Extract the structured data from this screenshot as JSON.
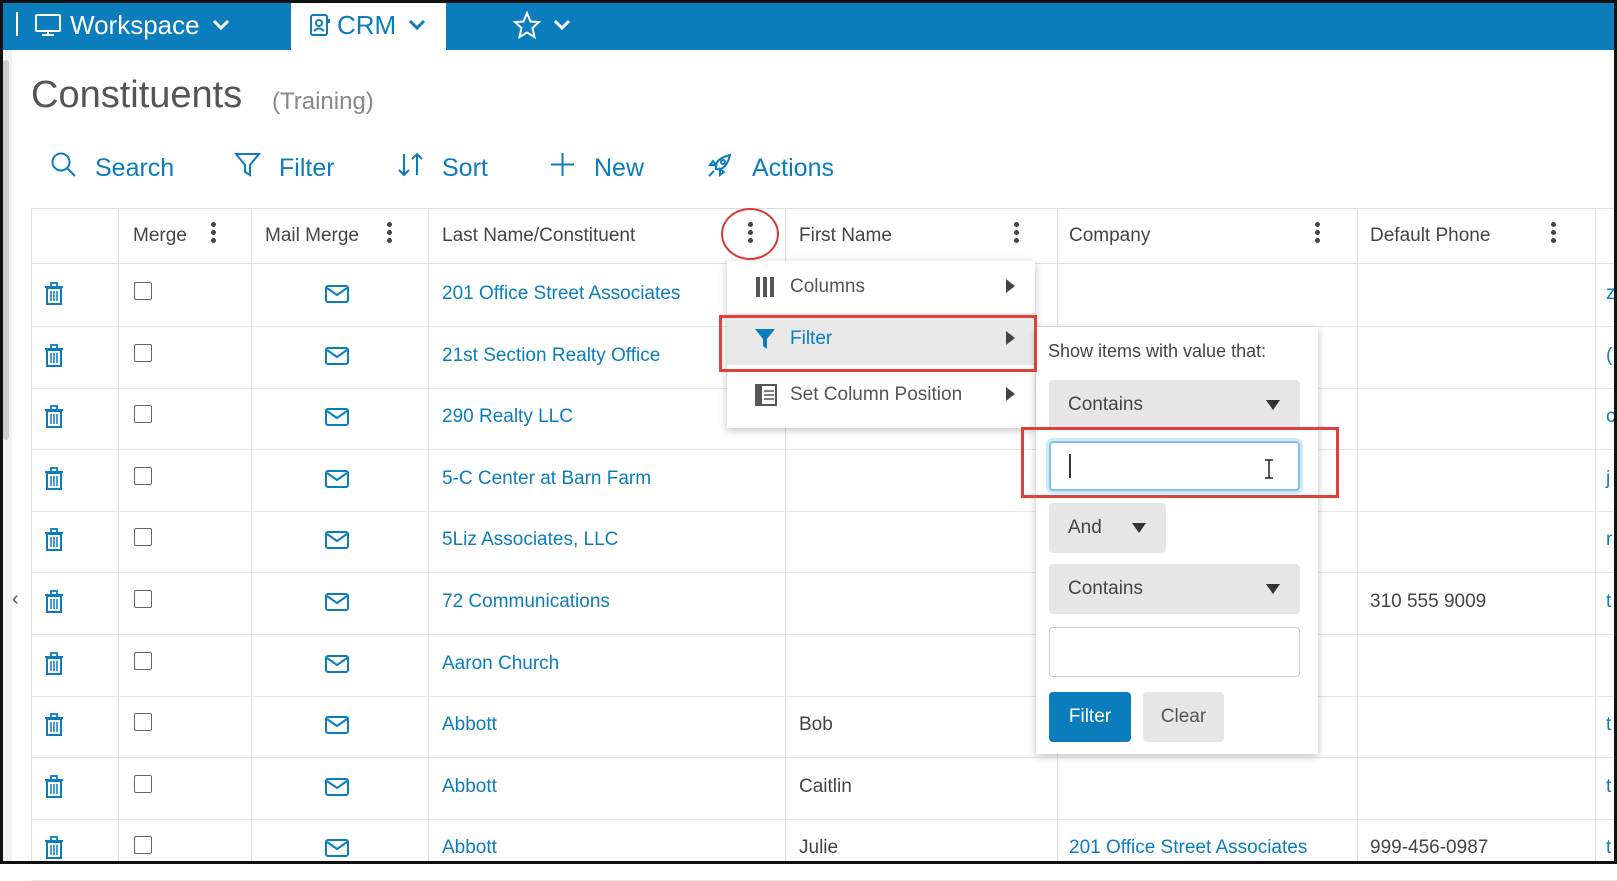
{
  "topbar": {
    "workspace_label": "Workspace",
    "crm_label": "CRM"
  },
  "page": {
    "title": "Constituents",
    "subtitle": "(Training)"
  },
  "toolbar": {
    "search_label": "Search",
    "filter_label": "Filter",
    "sort_label": "Sort",
    "new_label": "New",
    "actions_label": "Actions"
  },
  "grid": {
    "headers": [
      "Merge",
      "Mail Merge",
      "Last Name/Constituent",
      "First Name",
      "Company",
      "Default Phone"
    ],
    "rows": [
      {
        "last": "201 Office Street Associates",
        "first": "",
        "company": "",
        "phone": "",
        "edge": "z"
      },
      {
        "last": "21st Section Realty Office",
        "first": "",
        "company": "",
        "phone": "",
        "edge": "("
      },
      {
        "last": "290 Realty LLC",
        "first": "",
        "company": "",
        "phone": "",
        "edge": "c"
      },
      {
        "last": "5-C Center at Barn Farm",
        "first": "",
        "company": "",
        "phone": "",
        "edge": "j"
      },
      {
        "last": "5Liz Associates, LLC",
        "first": "",
        "company": "",
        "phone": "",
        "edge": "r"
      },
      {
        "last": "72 Communications",
        "first": "",
        "company": "",
        "phone": "310 555 9009",
        "edge": "t"
      },
      {
        "last": "Aaron Church",
        "first": "",
        "company": "",
        "phone": "",
        "edge": ""
      },
      {
        "last": "Abbott",
        "first": "Bob",
        "company": "",
        "phone": "",
        "edge": "t"
      },
      {
        "last": "Abbott",
        "first": "Caitlin",
        "company": "",
        "phone": "",
        "edge": "t"
      },
      {
        "last": "Abbott",
        "first": "Julie",
        "company": "201 Office Street Associates",
        "phone": "999-456-0987",
        "edge": "t"
      }
    ]
  },
  "column_menu": {
    "items": [
      {
        "label": "Columns",
        "icon": "columns-icon"
      },
      {
        "label": "Filter",
        "icon": "funnel-icon"
      },
      {
        "label": "Set Column Position",
        "icon": "column-position-icon"
      }
    ]
  },
  "filter_panel": {
    "prompt": "Show items with value that:",
    "operator1": "Contains",
    "value1": "",
    "logic": "And",
    "operator2": "Contains",
    "value2": "",
    "filter_button": "Filter",
    "clear_button": "Clear"
  },
  "colors": {
    "brand": "#0b7dbd",
    "annotation": "#e0403a"
  }
}
